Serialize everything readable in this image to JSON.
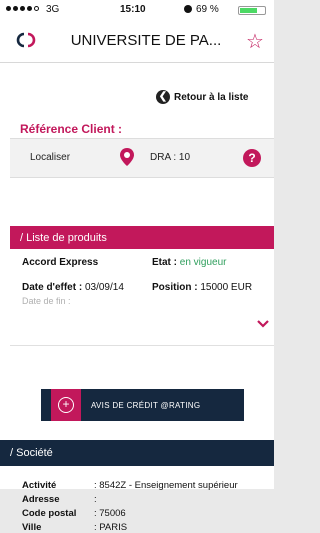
{
  "statusbar": {
    "carrier": "3G",
    "time": "15:10",
    "battery_text": "69 %",
    "battery_level": 0.69
  },
  "navbar": {
    "logo_icon": "connect-logo-icon",
    "title": "UNIVERSITE DE PA...",
    "star_icon": "star-icon"
  },
  "retour_label": "Retour à la liste",
  "reference_title": "Référence Client :",
  "localiser_label": "Localiser",
  "dra_label": "DRA : 10",
  "produits": {
    "section_title": "/ Liste de produits",
    "name": "Accord Express",
    "etat_label": "Etat :",
    "etat_value": "en vigueur",
    "date_effet_label": "Date d'effet :",
    "date_effet_value": "03/09/14",
    "position_label": "Position :",
    "position_value": "15000 EUR",
    "date_fin_label": "Date de fin :"
  },
  "avis_button_label": "AVIS DE CRÉDIT @RATING",
  "societe": {
    "section_title": "/ Société",
    "rows": [
      {
        "key": "Activité",
        "value": ": 8542Z - Enseignement supérieur"
      },
      {
        "key": "Adresse",
        "value": ":"
      },
      {
        "key": "Code postal",
        "value": ": 75006"
      },
      {
        "key": "Ville",
        "value": ": PARIS"
      }
    ]
  },
  "colors": {
    "accent": "#c2185b",
    "dark": "#15283f",
    "status_ok": "#2e9e5c"
  }
}
